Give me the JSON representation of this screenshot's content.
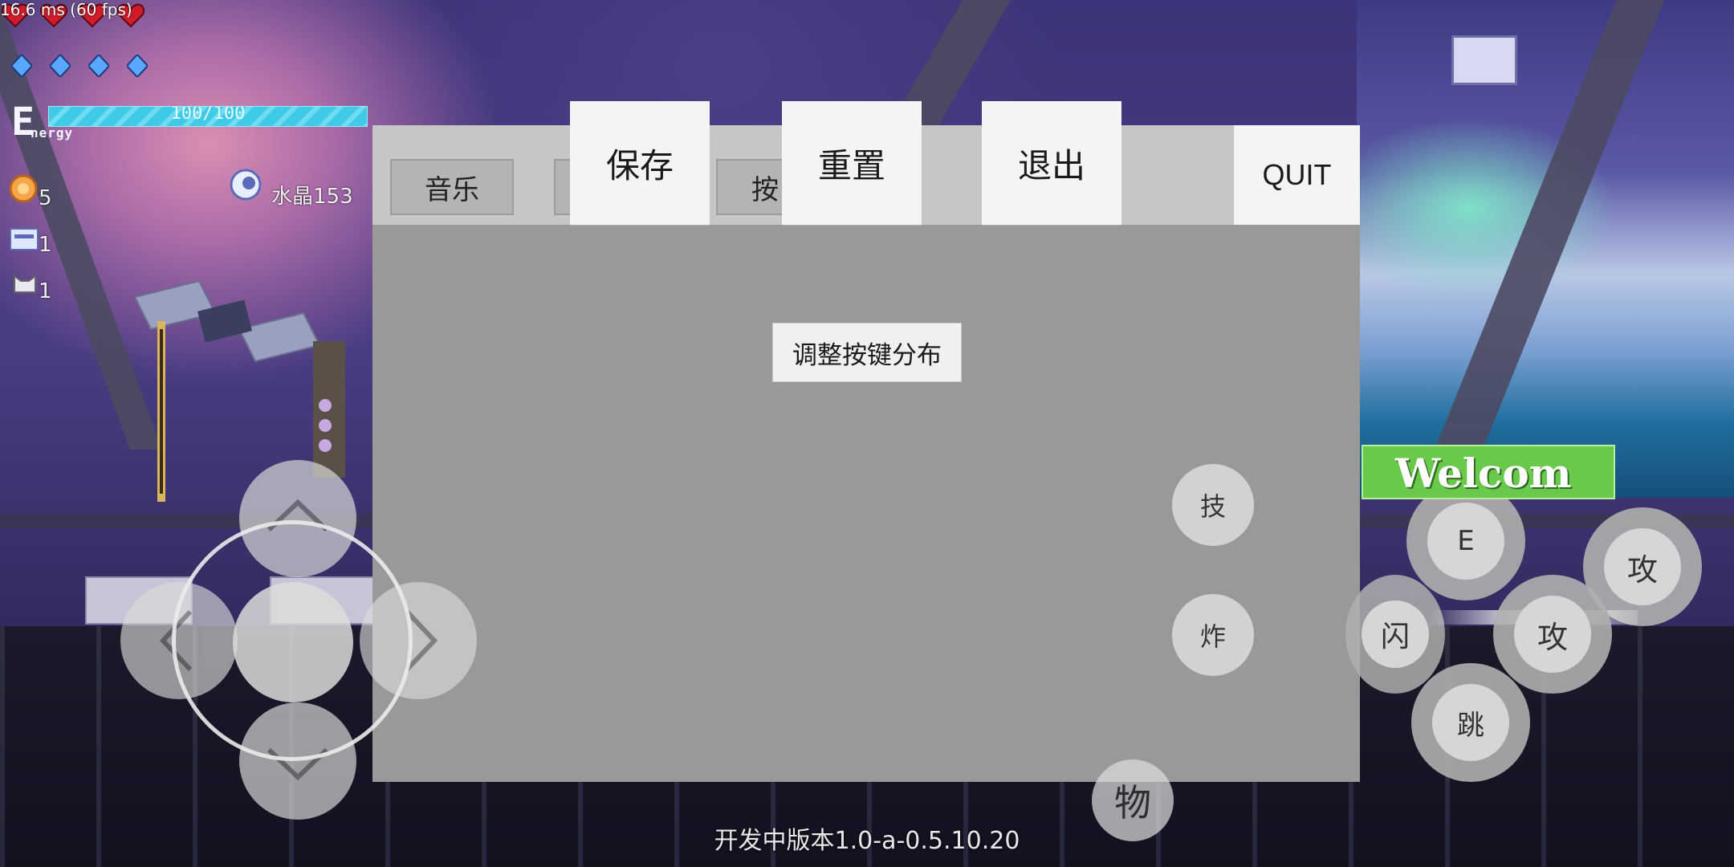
{
  "hud": {
    "fps_text": "16.6 ms (60 fps)",
    "health_hearts": 4,
    "shield_count": 4,
    "energy": {
      "label_letter": "E",
      "label_word": "nergy",
      "text": "100/100",
      "fraction": 1.0
    },
    "gold_count": "5",
    "crystal_text": "水晶153",
    "chip_count": "1",
    "cat_count": "1"
  },
  "settings_panel": {
    "tabs": [
      "音乐",
      "",
      "按"
    ],
    "save_label": "保存",
    "reset_label": "重置",
    "exit_label": "退出",
    "quit_label": "QUIT",
    "adjust_layout_label": "调整按键分布"
  },
  "controls": {
    "skill_label": "技",
    "bomb_label": "炸",
    "item_label": "物",
    "e_label": "E",
    "dodge_label": "闪",
    "attack_label": "攻",
    "attack2_label": "攻",
    "jump_label": "跳"
  },
  "welcome_sign": "Welcom",
  "version_text": "开发中版本1.0-a-0.5.10.20",
  "colors": {
    "panel_header": "#c6c6c6",
    "panel_body": "#999999",
    "button_bg": "#f4f4f4",
    "energy_fill": "#3fcbe8",
    "heart": "#d11a2a",
    "shield": "#5aa7ff",
    "welcome_sign": "#69c94a"
  }
}
